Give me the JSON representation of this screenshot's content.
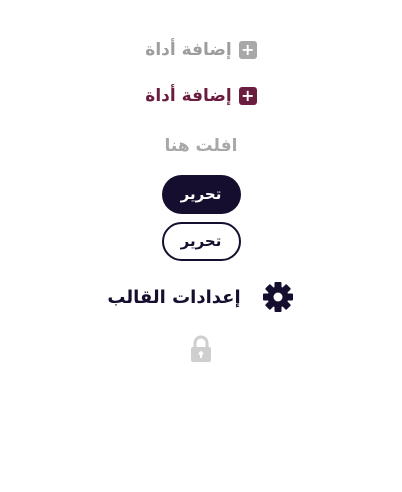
{
  "add_tool_muted": {
    "label": "إضافة أداة",
    "icon": "plus-square-icon"
  },
  "add_tool_active": {
    "label": "إضافة أداة",
    "icon": "plus-square-icon"
  },
  "drop_zone": {
    "text": "افلت هنا"
  },
  "edit_button_filled": {
    "label": "تحرير"
  },
  "edit_button_outline": {
    "label": "تحرير"
  },
  "template_settings": {
    "label": "إعدادات القالب",
    "icon": "gear-icon"
  },
  "lock": {
    "icon": "lock-icon"
  },
  "colors": {
    "muted": "#a8a8a8",
    "accent": "#6b1d3f",
    "dark": "#150e2e"
  }
}
